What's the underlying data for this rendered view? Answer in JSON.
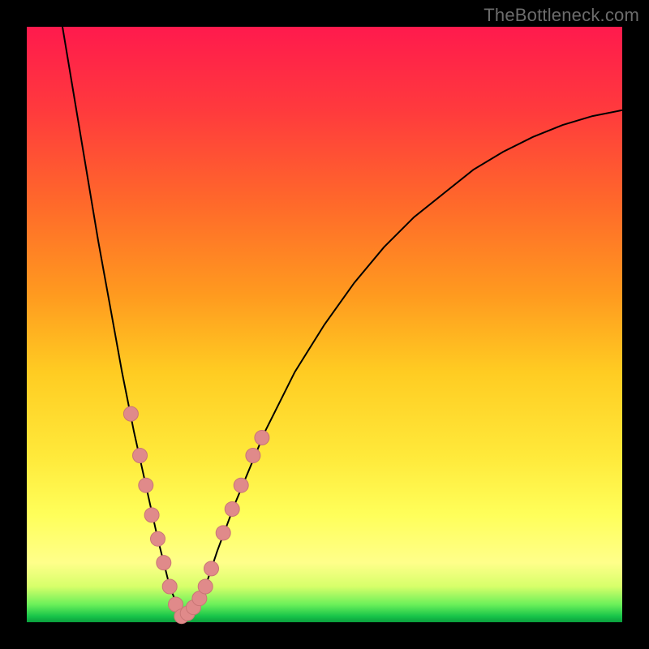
{
  "watermark": "TheBottleneck.com",
  "colors": {
    "frame": "#000000",
    "curve": "#000000",
    "marker_fill": "#e08a8a",
    "marker_stroke": "#c97676",
    "gradient_stops": [
      "#ff1a4d",
      "#ff3a3d",
      "#ff6a2a",
      "#ff9a1f",
      "#ffcc22",
      "#ffe93a",
      "#ffff5a",
      "#ffff8a",
      "#d7ff6a",
      "#6cf05a",
      "#18c44a",
      "#0aa03d"
    ]
  },
  "chart_data": {
    "type": "line",
    "title": "",
    "subtitle": "",
    "xlabel": "",
    "ylabel": "",
    "x_range": [
      0,
      100
    ],
    "y_range": [
      0,
      100
    ],
    "note": "Bottleneck-percentage style curve. Minimum (~0%) near x≈26. Axes are unlabeled in the source; values are read off the implicit 0–100 grid.",
    "series": [
      {
        "name": "bottleneck-curve",
        "x": [
          6,
          8,
          10,
          12,
          14,
          16,
          18,
          20,
          22,
          24,
          26,
          28,
          30,
          32,
          35,
          40,
          45,
          50,
          55,
          60,
          65,
          70,
          75,
          80,
          85,
          90,
          95,
          100
        ],
        "y": [
          100,
          88,
          76,
          64,
          53,
          42,
          32,
          23,
          14,
          6,
          1,
          2,
          6,
          12,
          20,
          32,
          42,
          50,
          57,
          63,
          68,
          72,
          76,
          79,
          81.5,
          83.5,
          85,
          86
        ]
      }
    ],
    "markers": {
      "name": "highlighted-points",
      "description": "Salmon dots near the trough of the curve",
      "points": [
        {
          "x": 17.5,
          "y": 35
        },
        {
          "x": 19,
          "y": 28
        },
        {
          "x": 20,
          "y": 23
        },
        {
          "x": 21,
          "y": 18
        },
        {
          "x": 22,
          "y": 14
        },
        {
          "x": 23,
          "y": 10
        },
        {
          "x": 24,
          "y": 6
        },
        {
          "x": 25,
          "y": 3
        },
        {
          "x": 26,
          "y": 1
        },
        {
          "x": 27,
          "y": 1.5
        },
        {
          "x": 28,
          "y": 2.5
        },
        {
          "x": 29,
          "y": 4
        },
        {
          "x": 30,
          "y": 6
        },
        {
          "x": 31,
          "y": 9
        },
        {
          "x": 33,
          "y": 15
        },
        {
          "x": 34.5,
          "y": 19
        },
        {
          "x": 36,
          "y": 23
        },
        {
          "x": 38,
          "y": 28
        },
        {
          "x": 39.5,
          "y": 31
        }
      ]
    }
  }
}
